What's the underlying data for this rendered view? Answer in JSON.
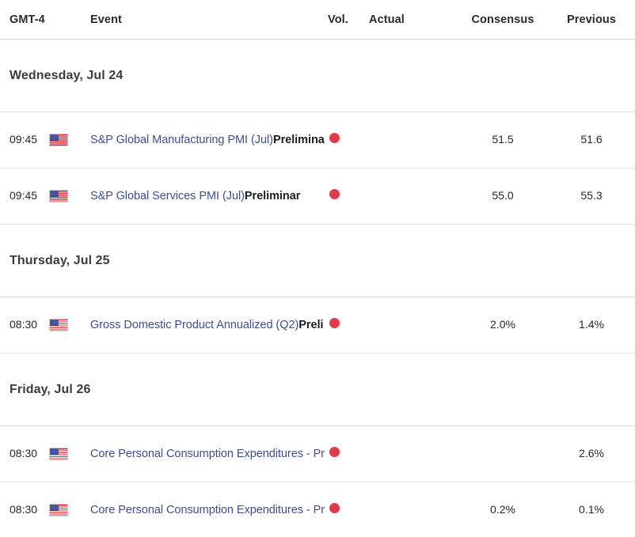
{
  "header": {
    "timezone_label": "GMT-4",
    "event_label": "Event",
    "vol_label": "Vol.",
    "actual_label": "Actual",
    "consensus_label": "Consensus",
    "previous_label": "Previous"
  },
  "colors": {
    "link": "#3f4d92",
    "volatility_high": "#e03b4a",
    "text": "#25262b",
    "divider": "#e3e5e8",
    "background": "#ffffff"
  },
  "groups": [
    {
      "date_label": "Wednesday, Jul 24",
      "events": [
        {
          "time": "09:45",
          "flag": "us-flag-icon",
          "country": "United States",
          "title": "S&P Global Manufacturing PMI (Jul)",
          "qualifier": "Preliminar",
          "truncated": false,
          "volatility": "high",
          "actual": "",
          "consensus": "51.5",
          "previous": "51.6"
        },
        {
          "time": "09:45",
          "flag": "us-flag-icon",
          "country": "United States",
          "title": "S&P Global Services PMI (Jul)",
          "qualifier": "Preliminar",
          "truncated": false,
          "volatility": "high",
          "actual": "",
          "consensus": "55.0",
          "previous": "55.3"
        }
      ]
    },
    {
      "date_label": "Thursday, Jul 25",
      "events": [
        {
          "time": "08:30",
          "flag": "us-flag-icon",
          "country": "United States",
          "title": "Gross Domestic Product Annualized (Q2)",
          "qualifier": "Preli",
          "truncated": true,
          "volatility": "high",
          "actual": "",
          "consensus": "2.0%",
          "previous": "1.4%"
        }
      ]
    },
    {
      "date_label": "Friday, Jul 26",
      "events": [
        {
          "time": "08:30",
          "flag": "us-flag-icon",
          "country": "United States",
          "title": "Core Personal Consumption Expenditures - Pri",
          "qualifier": "",
          "truncated": true,
          "volatility": "high",
          "actual": "",
          "consensus": "",
          "previous": "2.6%"
        },
        {
          "time": "08:30",
          "flag": "us-flag-icon",
          "country": "United States",
          "title": "Core Personal Consumption Expenditures - Pri",
          "qualifier": "",
          "truncated": true,
          "volatility": "high",
          "actual": "",
          "consensus": "0.2%",
          "previous": "0.1%"
        }
      ]
    }
  ]
}
